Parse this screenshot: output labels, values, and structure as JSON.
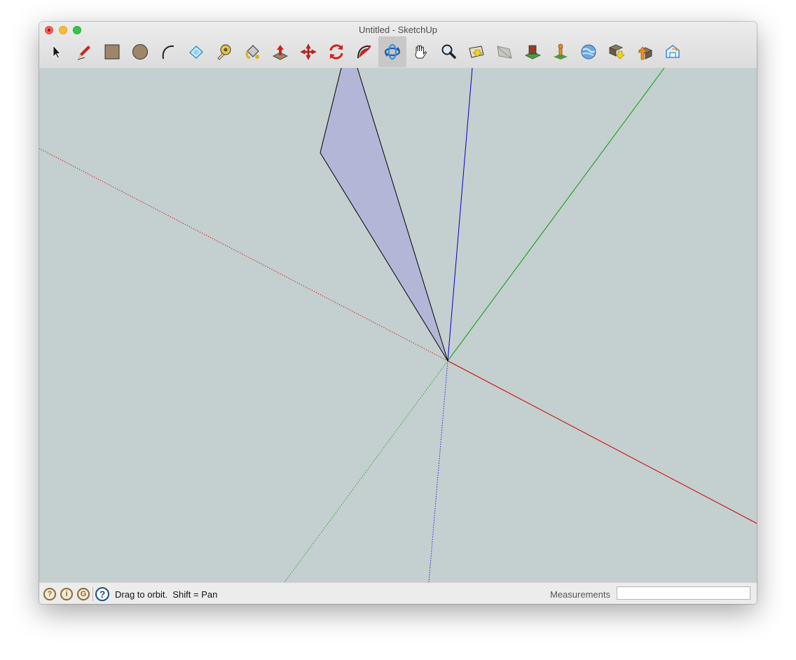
{
  "window": {
    "title": "Untitled - SketchUp"
  },
  "toolbar": {
    "tools": [
      {
        "name": "select",
        "icon": "arrow-cursor-icon"
      },
      {
        "name": "line",
        "icon": "pencil-icon"
      },
      {
        "name": "rectangle",
        "icon": "rectangle-icon"
      },
      {
        "name": "circle",
        "icon": "circle-icon"
      },
      {
        "name": "arc",
        "icon": "arc-icon"
      },
      {
        "name": "eraser",
        "icon": "eraser-icon"
      },
      {
        "name": "tape-measure",
        "icon": "tape-measure-icon"
      },
      {
        "name": "paint-bucket",
        "icon": "paint-bucket-icon"
      },
      {
        "name": "push-pull",
        "icon": "push-pull-icon"
      },
      {
        "name": "move",
        "icon": "move-icon"
      },
      {
        "name": "rotate",
        "icon": "rotate-icon"
      },
      {
        "name": "follow-me",
        "icon": "follow-me-icon"
      },
      {
        "name": "orbit",
        "icon": "orbit-icon",
        "active": true
      },
      {
        "name": "pan",
        "icon": "hand-icon"
      },
      {
        "name": "zoom",
        "icon": "magnifier-icon"
      },
      {
        "name": "zoom-extents",
        "icon": "zoom-extents-icon"
      },
      {
        "name": "previous-view",
        "icon": "previous-view-icon"
      },
      {
        "name": "add-location",
        "icon": "add-location-icon"
      },
      {
        "name": "toggle-terrain",
        "icon": "terrain-icon"
      },
      {
        "name": "preview-google-earth",
        "icon": "earth-icon"
      },
      {
        "name": "get-models",
        "icon": "get-models-icon"
      },
      {
        "name": "share-model",
        "icon": "share-model-icon"
      },
      {
        "name": "extension-warehouse",
        "icon": "extension-warehouse-icon"
      }
    ]
  },
  "statusbar": {
    "hint": "Drag to orbit.  Shift = Pan",
    "measurements_label": "Measurements",
    "measurements_value": "",
    "icons": [
      {
        "name": "geo-location-icon",
        "glyph": "?"
      },
      {
        "name": "credits-icon",
        "glyph": "i"
      },
      {
        "name": "sign-in-icon",
        "glyph": "G"
      }
    ],
    "help_glyph": "?"
  },
  "viewport": {
    "background": "#c4cfcf",
    "axis_colors": {
      "red": "#cc0000",
      "green": "#0a9a0a",
      "blue": "#0000cc"
    },
    "face_fill": "#b3b7d7",
    "edge_color": "#000000"
  }
}
